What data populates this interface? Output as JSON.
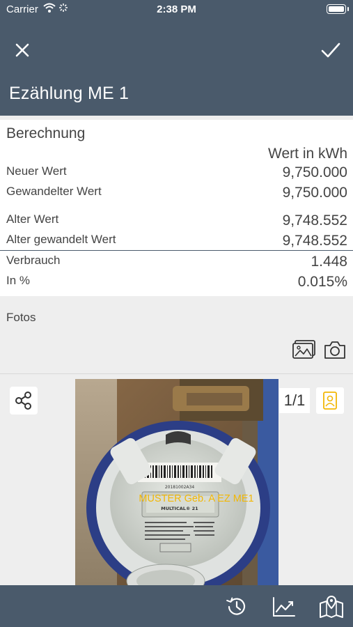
{
  "status_bar": {
    "carrier": "Carrier",
    "time": "2:38 PM"
  },
  "nav": {
    "title": "Ezählung ME 1",
    "close_icon": "close-icon",
    "confirm_icon": "checkmark-icon"
  },
  "berechnung": {
    "title": "Berechnung",
    "column_header": "Wert in kWh",
    "rows": [
      {
        "label": "Neuer Wert",
        "value": "9,750.000"
      },
      {
        "label": "Gewandelter Wert",
        "value": "9,750.000"
      },
      {
        "label": "Alter Wert",
        "value": "9,748.552"
      },
      {
        "label": "Alter gewandelt Wert",
        "value": "9,748.552"
      },
      {
        "label": "Verbrauch",
        "value": "1.448"
      },
      {
        "label": "In %",
        "value": "0.015%"
      }
    ]
  },
  "fotos": {
    "label": "Fotos",
    "gallery_icon": "image-gallery-icon",
    "camera_icon": "camera-icon"
  },
  "photo_viewer": {
    "counter": "1/1",
    "watermark": "MUSTER Geb. A EZ ME1",
    "meter_brand": "MULTICAL® 21",
    "meter_serial": "20181002A34",
    "share_icon": "share-icon",
    "contact_icon": "contact-card-icon"
  },
  "bottom_bar": {
    "items": [
      "history-icon",
      "chart-trend-icon",
      "map-icon"
    ]
  },
  "colors": {
    "header": "#4a5a6b",
    "accent": "#f2b705",
    "background": "#eeeeee"
  }
}
